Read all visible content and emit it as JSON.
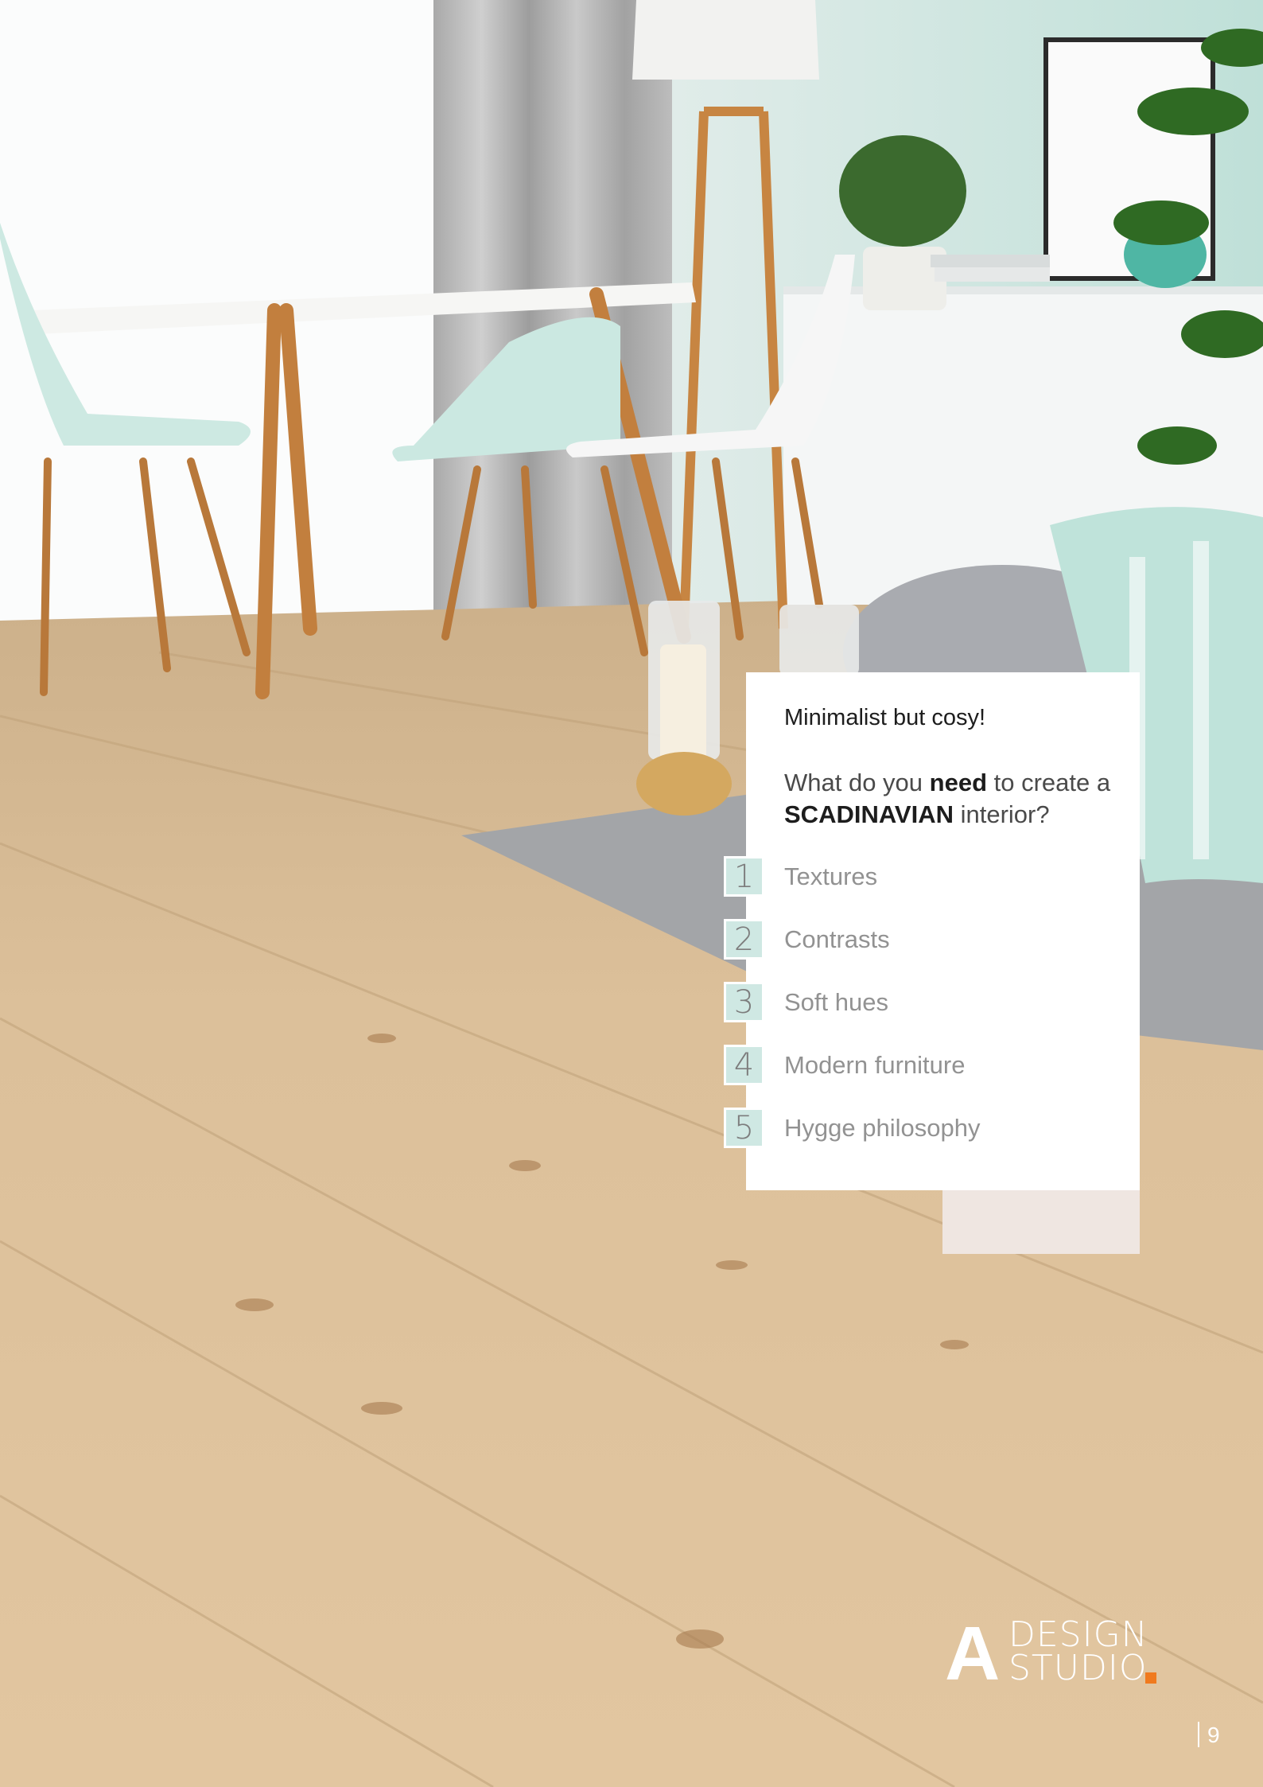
{
  "card": {
    "title": "Minimalist but cosy!",
    "question_prefix": "What do you ",
    "question_bold1": "need",
    "question_mid": " to create a ",
    "question_bold2": "SCADINAVIAN",
    "question_suffix": " interior?",
    "items": [
      {
        "number": "1",
        "label": "Textures"
      },
      {
        "number": "2",
        "label": "Contrasts"
      },
      {
        "number": "3",
        "label": "Soft hues"
      },
      {
        "number": "4",
        "label": "Modern furniture"
      },
      {
        "number": "5",
        "label": "Hygge philosophy"
      }
    ]
  },
  "logo": {
    "letter": "A",
    "line1": "DESIGN",
    "line2": "STUDIO",
    "accent_color": "#f07a1e"
  },
  "page_number": "9",
  "colors": {
    "number_box": "#cfe8e3",
    "card_tab": "#efe6e1",
    "floor": "#d8b98e"
  }
}
